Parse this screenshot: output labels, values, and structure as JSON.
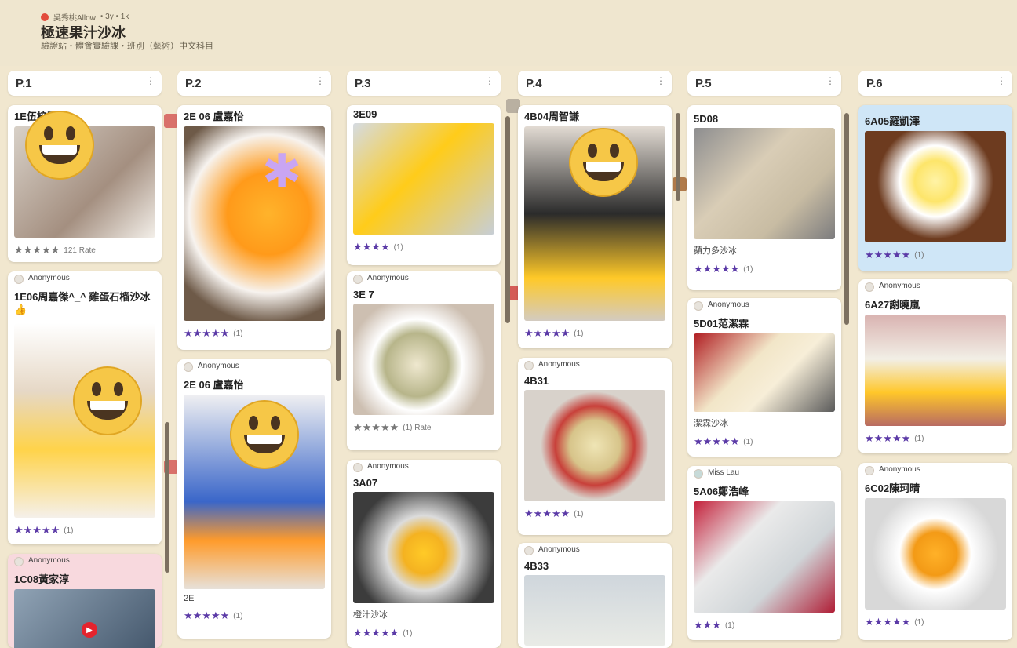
{
  "board": {
    "author": "吳秀桃Allow",
    "time_meta": "• 3y • 1k",
    "title": "極速果汁沙冰",
    "subtitle": "驗證站・體會實驗課・班別（藝術）中文科目"
  },
  "colors": {
    "accent": "#5b3aa7",
    "background": "#f1e7cf"
  },
  "columns": [
    {
      "title": "P.1",
      "menu": "⋮"
    },
    {
      "title": "P.2",
      "menu": "⋮"
    },
    {
      "title": "P.3",
      "menu": "⋮"
    },
    {
      "title": "P.4",
      "menu": "⋮"
    },
    {
      "title": "P.5",
      "menu": "⋮"
    },
    {
      "title": "P.6",
      "menu": "⋮"
    }
  ],
  "cards": {
    "c1a": {
      "title": "1E伍梓熙",
      "stars": "★★★★★",
      "count": "121 Rate"
    },
    "c1b": {
      "author": "Anonymous",
      "title": "1E06周嘉傑^_^ 雞蛋石榴沙冰 👍",
      "stars": "★★★★★",
      "count": "(1)"
    },
    "c1c": {
      "author": "Anonymous",
      "title": "1C08黃家淳"
    },
    "c2a": {
      "title": "2E 06 盧嘉怡",
      "stars": "★★★★★",
      "count": "(1)"
    },
    "c2b": {
      "author": "Anonymous",
      "title": "2E 06 盧嘉怡",
      "sub": "2E",
      "stars": "★★★★★",
      "count": "(1)"
    },
    "c3a": {
      "title": "3E09",
      "stars": "★★★★",
      "count": "(1)"
    },
    "c3b": {
      "author": "Anonymous",
      "title": "3E 7",
      "stars": "★★★★★",
      "count": "(1) Rate"
    },
    "c3c": {
      "author": "Anonymous",
      "title": "3A07",
      "sub": "橙汁沙冰",
      "stars": "★★★★★",
      "count": "(1)"
    },
    "c4a": {
      "title": "4B04周智謙",
      "stars": "★★★★★",
      "count": "(1)"
    },
    "c4b": {
      "author": "Anonymous",
      "title": "4B31",
      "stars": "★★★★★",
      "count": "(1)"
    },
    "c4c": {
      "author": "Anonymous",
      "title": "4B33"
    },
    "c5a": {
      "title": "5D08",
      "sub": "蘋力多沙冰",
      "stars": "★★★★★",
      "count": "(1)"
    },
    "c5b": {
      "author": "Anonymous",
      "title": "5D01范潔霖",
      "sub": "潔霖沙冰",
      "stars": "★★★★★",
      "count": "(1)"
    },
    "c5c": {
      "author": "Miss Lau",
      "title": "5A06鄭浩峰",
      "stars": "★★★",
      "count": "(1)"
    },
    "c6a": {
      "title": "6A05羅凱澤",
      "stars": "★★★★★",
      "count": "(1)"
    },
    "c6b": {
      "author": "Anonymous",
      "title": "6A27謝曉嵐",
      "stars": "★★★★★",
      "count": "(1)"
    },
    "c6c": {
      "author": "Anonymous",
      "title": "6C02陳珂晴",
      "stars": "★★★★★",
      "count": "(1)"
    }
  }
}
